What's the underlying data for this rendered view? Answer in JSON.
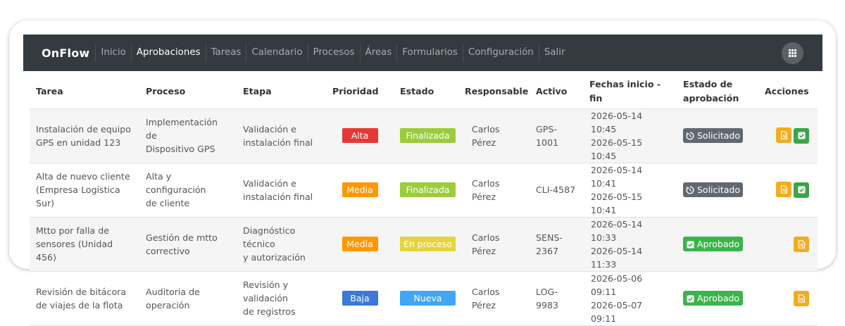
{
  "nav": {
    "brand": "OnFlow",
    "items": [
      "Inicio",
      "Aprobaciones",
      "Tareas",
      "Calendario",
      "Procesos",
      "Áreas",
      "Formularios",
      "Configuración",
      "Salir"
    ],
    "active": "Aprobaciones",
    "apps_icon": "grid-icon"
  },
  "table": {
    "headers": [
      "Tarea",
      "Proceso",
      "Etapa",
      "Prioridad",
      "Estado",
      "Responsable",
      "Activo",
      "Fechas inicio - fin",
      "Estado de aprobación",
      "Acciones"
    ],
    "rows": [
      {
        "tarea": [
          "Instalación de equipo",
          "GPS en unidad 123"
        ],
        "proceso": [
          "Implementación de",
          "Dispositivo GPS"
        ],
        "etapa": [
          "Validación e",
          "instalación final"
        ],
        "prioridad": "Alta",
        "estado": "Finalizada",
        "responsable": [
          "Carlos",
          "Pérez"
        ],
        "activo": "GPS-1001",
        "fechas": [
          "2026-05-14 10:45",
          "2026-05-15 10:45"
        ],
        "aprobacion": "Solicitado",
        "acciones": [
          "document-icon",
          "check-icon"
        ]
      },
      {
        "tarea": [
          "Alta de nuevo cliente",
          "(Empresa Logística Sur)"
        ],
        "proceso": [
          "Alta y configuración",
          "de cliente"
        ],
        "etapa": [
          "Validación e",
          "instalación final"
        ],
        "prioridad": "Media",
        "estado": "Finalizada",
        "responsable": [
          "Carlos",
          "Pérez"
        ],
        "activo": "CLI-4587",
        "fechas": [
          "2026-05-14 10:41",
          "2026-05-15 10:41"
        ],
        "aprobacion": "Solicitado",
        "acciones": [
          "document-icon",
          "check-icon"
        ]
      },
      {
        "tarea": [
          "Mtto por falla de",
          "sensores (Unidad 456)"
        ],
        "proceso": [
          "Gestión de mtto",
          "correctivo"
        ],
        "etapa": [
          "Diagnóstico técnico",
          "y autorización"
        ],
        "prioridad": "Media",
        "estado": "En proceso",
        "responsable": [
          "Carlos",
          "Pérez"
        ],
        "activo": "SENS-2367",
        "fechas": [
          "2026-05-14 10:33",
          "2026-05-14 11:33"
        ],
        "aprobacion": "Aprobado",
        "acciones": [
          "document-icon"
        ]
      },
      {
        "tarea": [
          "Revisión de bitácora",
          "de viajes de la flota"
        ],
        "proceso": [
          "Auditoria de",
          "operación"
        ],
        "etapa": [
          "Revisión y validación",
          "de registros"
        ],
        "prioridad": "Baja",
        "estado": "Nueva",
        "responsable": [
          "Carlos",
          "Pérez"
        ],
        "activo": "LOG-9983",
        "fechas": [
          "2026-05-06 09:11",
          "2026-05-07 09:11"
        ],
        "aprobacion": "Aprobado",
        "acciones": [
          "document-icon"
        ]
      }
    ]
  },
  "colors": {
    "navbar": "#343a40",
    "prioridad": {
      "Alta": "#e53935",
      "Media": "#ff9800",
      "Baja": "#3b78d8"
    },
    "estado": {
      "Finalizada": "#9ccc3b",
      "En proceso": "#e6d43c",
      "Nueva": "#42a5f5"
    },
    "aprobacion": {
      "Solicitado": "#616870",
      "Aprobado": "#3bb54a"
    },
    "accion_doc": "#f0ad1f",
    "accion_ok": "#3aa548"
  }
}
